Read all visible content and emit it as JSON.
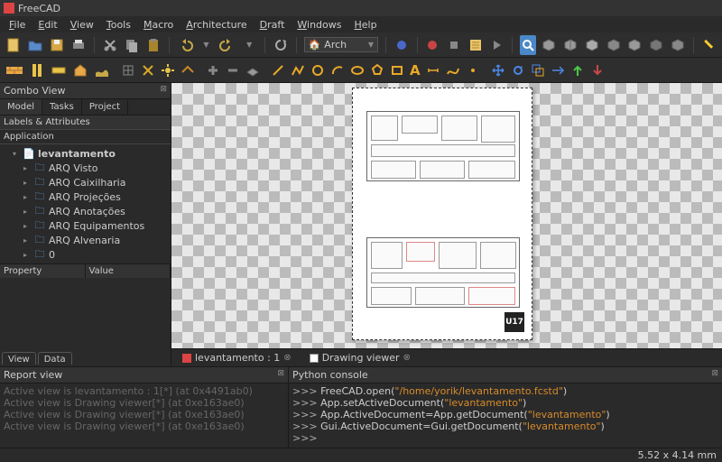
{
  "title": "FreeCAD",
  "menu": [
    "File",
    "Edit",
    "View",
    "Tools",
    "Macro",
    "Architecture",
    "Draft",
    "Windows",
    "Help"
  ],
  "workbench": {
    "label": "Arch",
    "icon": "🏠"
  },
  "combo": {
    "title": "Combo View",
    "tabs": [
      "Model",
      "Tasks",
      "Project"
    ],
    "active_tab": 0,
    "labels_hdr": "Labels & Attributes",
    "app_hdr": "Application",
    "root": "levantamento",
    "items": [
      "ARQ Visto",
      "ARQ Caixilharia",
      "ARQ Projeções",
      "ARQ Anotações",
      "ARQ Equipamentos",
      "ARQ Alvenaria",
      "0"
    ],
    "prop_cols": [
      "Property",
      "Value"
    ],
    "bottom_tabs": [
      "View",
      "Data"
    ]
  },
  "doc_tabs": [
    {
      "label": "levantamento : 1",
      "icon": "fc"
    },
    {
      "label": "Drawing viewer",
      "icon": "check"
    }
  ],
  "report": {
    "title": "Report view",
    "lines": [
      "Active view is levantamento : 1[*] (at 0x4491ab0)",
      "Active view is Drawing viewer[*] (at 0xe163ae0)",
      "Active view is Drawing viewer[*] (at 0xe163ae0)",
      "Active view is Drawing viewer[*] (at 0xe163ae0)"
    ]
  },
  "python": {
    "title": "Python console",
    "lines": [
      {
        "pre": ">>> ",
        "fn": "FreeCAD.open(",
        "str": "\"/home/yorik/levantamento.fcstd\"",
        "post": ")"
      },
      {
        "pre": ">>> ",
        "fn": "App.setActiveDocument(",
        "str": "\"levantamento\"",
        "post": ")"
      },
      {
        "pre": ">>> ",
        "fn": "App.ActiveDocument=App.getDocument(",
        "str": "\"levantamento\"",
        "post": ")"
      },
      {
        "pre": ">>> ",
        "fn": "Gui.ActiveDocument=Gui.getDocument(",
        "str": "\"levantamento\"",
        "post": ")"
      },
      {
        "pre": ">>> ",
        "fn": "",
        "str": "",
        "post": ""
      }
    ]
  },
  "status": "5.52 x 4.14  mm",
  "stamp": "U17"
}
